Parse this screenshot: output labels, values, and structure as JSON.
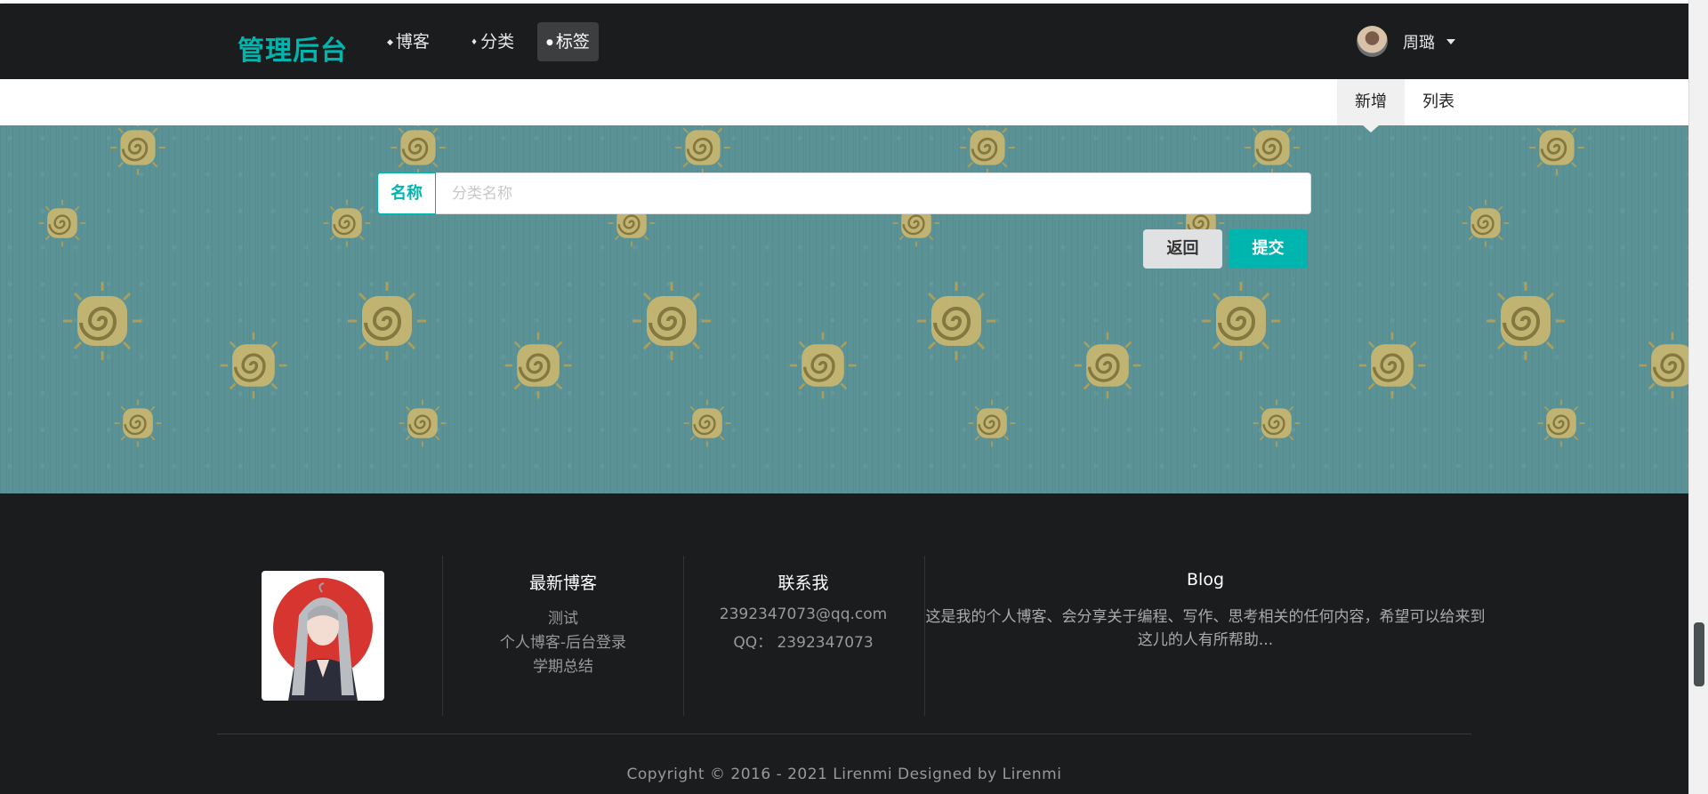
{
  "navbar": {
    "brand": "管理后台",
    "items": [
      {
        "label": "博客"
      },
      {
        "label": "分类"
      },
      {
        "label": "标签"
      }
    ],
    "user": {
      "name": "周璐"
    }
  },
  "submenu": {
    "items": [
      {
        "label": "新增"
      },
      {
        "label": "列表"
      }
    ]
  },
  "form": {
    "name_label": "名称",
    "name_placeholder": "分类名称",
    "name_value": "",
    "back_label": "返回",
    "submit_label": "提交"
  },
  "footer": {
    "latest_title": "最新博客",
    "latest_items": [
      "测试",
      "个人博客-后台登录",
      "学期总结"
    ],
    "contact_title": "联系我",
    "contact_email": "2392347073@qq.com",
    "contact_qq": "QQ：  2392347073",
    "blog_title": "Blog",
    "blog_desc": "这是我的个人博客、会分享关于编程、写作、思考相关的任何内容，希望可以给来到这儿的人有所帮助...",
    "copyright": "Copyright © 2016 - 2021 Lirenmi Designed by Lirenmi"
  },
  "colors": {
    "accent": "#00b5ad",
    "navbar_bg": "#1b1c1d",
    "banner_bg": "#5a9296"
  }
}
